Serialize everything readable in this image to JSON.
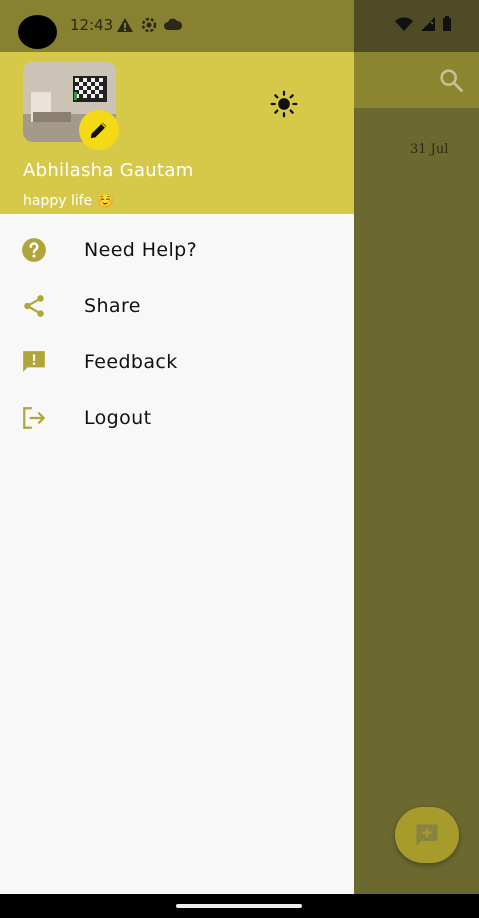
{
  "status_bar": {
    "time": "12:43"
  },
  "background": {
    "date": "31 Jul"
  },
  "drawer": {
    "header": {
      "user_name": "Abhilasha Gautam",
      "user_status": "happy life ☺️"
    },
    "menu": [
      {
        "label": "Need Help?",
        "icon": "help-circle-icon"
      },
      {
        "label": "Share",
        "icon": "share-icon"
      },
      {
        "label": "Feedback",
        "icon": "feedback-icon"
      },
      {
        "label": "Logout",
        "icon": "logout-icon"
      }
    ]
  },
  "colors": {
    "header_bg": "#d6c94a",
    "accent_icon": "#b0a53a",
    "edit_badge": "#f4da16",
    "drawer_bg": "#f8f8f8"
  }
}
